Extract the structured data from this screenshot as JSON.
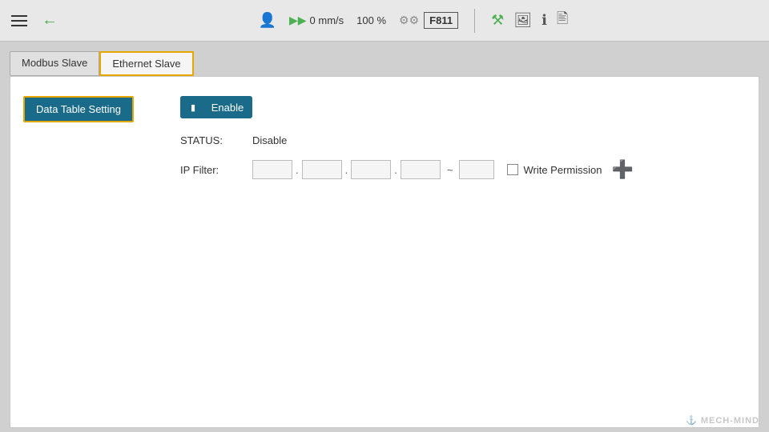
{
  "header": {
    "speed": "0 mm/s",
    "percent": "100 %",
    "model": "F811"
  },
  "tabs": [
    {
      "id": "modbus",
      "label": "Modbus Slave",
      "active": false
    },
    {
      "id": "ethernet",
      "label": "Ethernet Slave",
      "active": true
    }
  ],
  "sidebar": {
    "data_table_button": "Data Table Setting"
  },
  "card": {
    "enable_label": "Enable",
    "status_label": "STATUS:",
    "status_value": "Disable",
    "ip_filter_label": "IP Filter:",
    "ip_segments": [
      "",
      "",
      "",
      ""
    ],
    "ip_end": "",
    "write_permission_label": "Write Permission"
  },
  "watermark": {
    "brand": "MECH-MIND"
  }
}
